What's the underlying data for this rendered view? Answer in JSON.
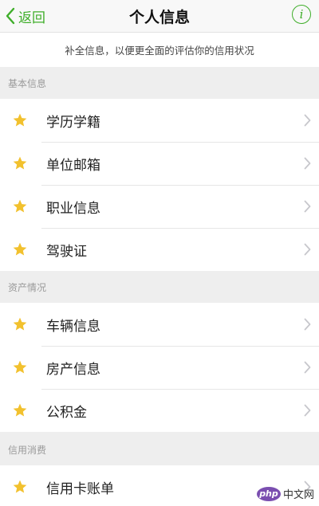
{
  "nav": {
    "back_label": "返回",
    "title": "个人信息",
    "info_icon": "info-icon",
    "accent": "#3fae2a"
  },
  "hint": {
    "text": "补全信息，以便更全面的评估你的信用状况"
  },
  "sections": [
    {
      "header": "基本信息",
      "items": [
        {
          "label": "学历学籍",
          "icon": "star-icon"
        },
        {
          "label": "单位邮箱",
          "icon": "star-icon"
        },
        {
          "label": "职业信息",
          "icon": "star-icon"
        },
        {
          "label": "驾驶证",
          "icon": "star-icon"
        }
      ]
    },
    {
      "header": "资产情况",
      "items": [
        {
          "label": "车辆信息",
          "icon": "star-icon"
        },
        {
          "label": "房产信息",
          "icon": "star-icon"
        },
        {
          "label": "公积金",
          "icon": "star-icon"
        }
      ]
    },
    {
      "header": "信用消费",
      "items": [
        {
          "label": "信用卡账单",
          "icon": "star-icon"
        }
      ]
    }
  ],
  "watermark": {
    "logo": "php",
    "text": "中文网"
  },
  "colors": {
    "star": "#f2c12e",
    "chevron": "#c7c7cc"
  }
}
